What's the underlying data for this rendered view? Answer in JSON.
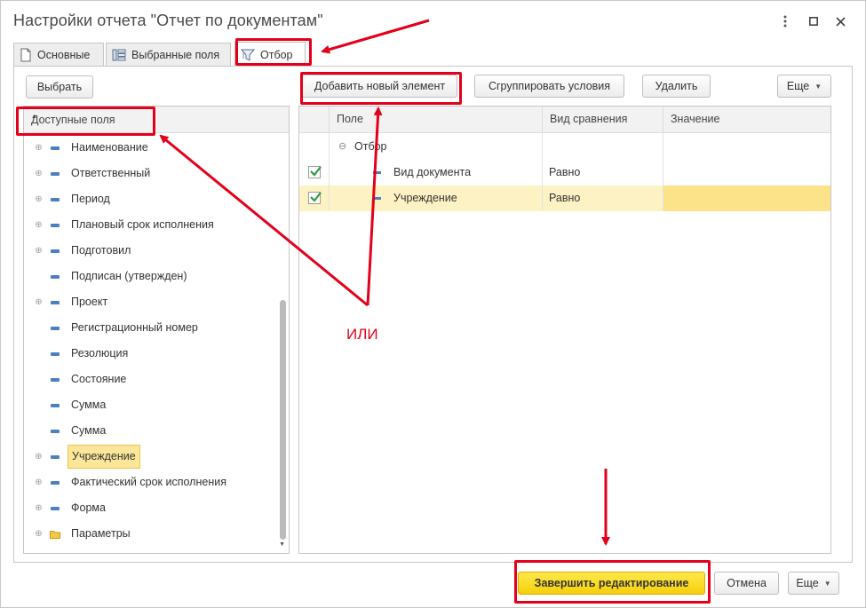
{
  "window": {
    "title": "Настройки отчета \"Отчет по документам\"",
    "menu_icon": "more-vertical-icon",
    "maximize_icon": "maximize-icon",
    "close_icon": "close-icon"
  },
  "tabs": [
    {
      "label": "Основные",
      "icon": "document-icon"
    },
    {
      "label": "Выбранные поля",
      "icon": "table-fields-icon"
    },
    {
      "label": "Отбор",
      "icon": "filter-icon",
      "active": true
    }
  ],
  "left": {
    "choose_button": "Выбрать",
    "header": "Доступные поля",
    "items": [
      {
        "label": "Наименование",
        "expandable": true,
        "icon": "field-icon"
      },
      {
        "label": "Ответственный",
        "expandable": true,
        "icon": "field-icon"
      },
      {
        "label": "Период",
        "expandable": true,
        "icon": "field-icon"
      },
      {
        "label": "Плановый срок исполнения",
        "expandable": true,
        "icon": "field-icon"
      },
      {
        "label": "Подготовил",
        "expandable": true,
        "icon": "field-icon"
      },
      {
        "label": "Подписан (утвержден)",
        "expandable": false,
        "icon": "field-icon"
      },
      {
        "label": "Проект",
        "expandable": true,
        "icon": "field-icon"
      },
      {
        "label": "Регистрационный номер",
        "expandable": false,
        "icon": "field-icon"
      },
      {
        "label": "Резолюция",
        "expandable": false,
        "icon": "field-icon"
      },
      {
        "label": "Состояние",
        "expandable": false,
        "icon": "field-icon"
      },
      {
        "label": "Сумма",
        "expandable": false,
        "icon": "field-icon"
      },
      {
        "label": "Сумма",
        "expandable": false,
        "icon": "field-icon"
      },
      {
        "label": "Учреждение",
        "expandable": true,
        "icon": "field-icon",
        "selected": true
      },
      {
        "label": "Фактический срок исполнения",
        "expandable": true,
        "icon": "field-icon"
      },
      {
        "label": "Форма",
        "expandable": true,
        "icon": "field-icon"
      },
      {
        "label": "Параметры",
        "expandable": true,
        "icon": "folder-icon"
      }
    ]
  },
  "right": {
    "toolbar": {
      "add_button": "Добавить новый элемент",
      "group_button": "Сгруппировать условия",
      "delete_button": "Удалить",
      "more_button": "Еще"
    },
    "columns": [
      "Поле",
      "Вид сравнения",
      "Значение"
    ],
    "group_label": "Отбор",
    "rows": [
      {
        "checked": true,
        "field": "Вид документа",
        "comparison": "Равно",
        "value": ""
      },
      {
        "checked": true,
        "field": "Учреждение",
        "comparison": "Равно",
        "value": "",
        "selected": true
      }
    ]
  },
  "footer": {
    "finish_button": "Завершить редактирование",
    "cancel_button": "Отмена",
    "more_button": "Еще"
  },
  "annotations": {
    "or_text": "ИЛИ",
    "color": "#e3001b"
  },
  "colors": {
    "primary_button": "#f5cf0a",
    "selection": "#fbe69a",
    "field_icon": "#4a7fc0",
    "checkmark": "#2f9a3a"
  }
}
